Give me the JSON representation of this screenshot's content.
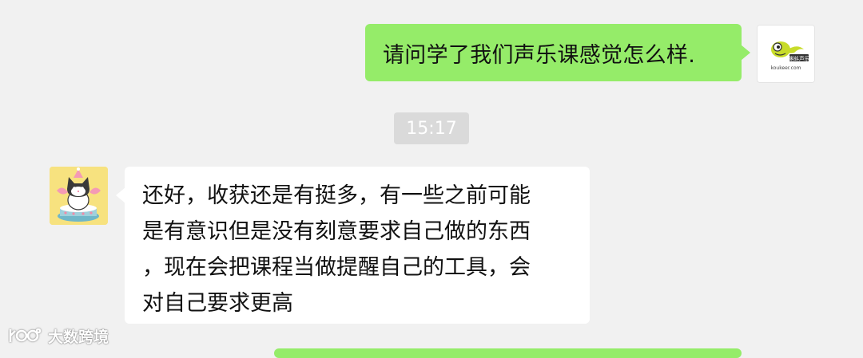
{
  "chat": {
    "outgoing_message": "请问学了我们声乐课感觉怎么样.",
    "timestamp": "15:17",
    "incoming_lines": [
      "还好，收获还是有挺多，有一些之前可能",
      "是有意识但是没有刻意要求自己做的东西",
      "，现在会把课程当做提醒自己的工具，会",
      "对自己要求更高"
    ]
  },
  "avatars": {
    "right_logo_text": "koukeer.com",
    "right_logo_cn": "蝌蚪声乐",
    "left_icon": "cartoon-cat-avatar"
  },
  "watermark": {
    "text": "大数跨境",
    "icon": "logo-icon"
  },
  "colors": {
    "background": "#f1f1f1",
    "outgoing_bubble": "#95ec69",
    "incoming_bubble": "#ffffff",
    "timestamp_pill": "#dadada"
  }
}
